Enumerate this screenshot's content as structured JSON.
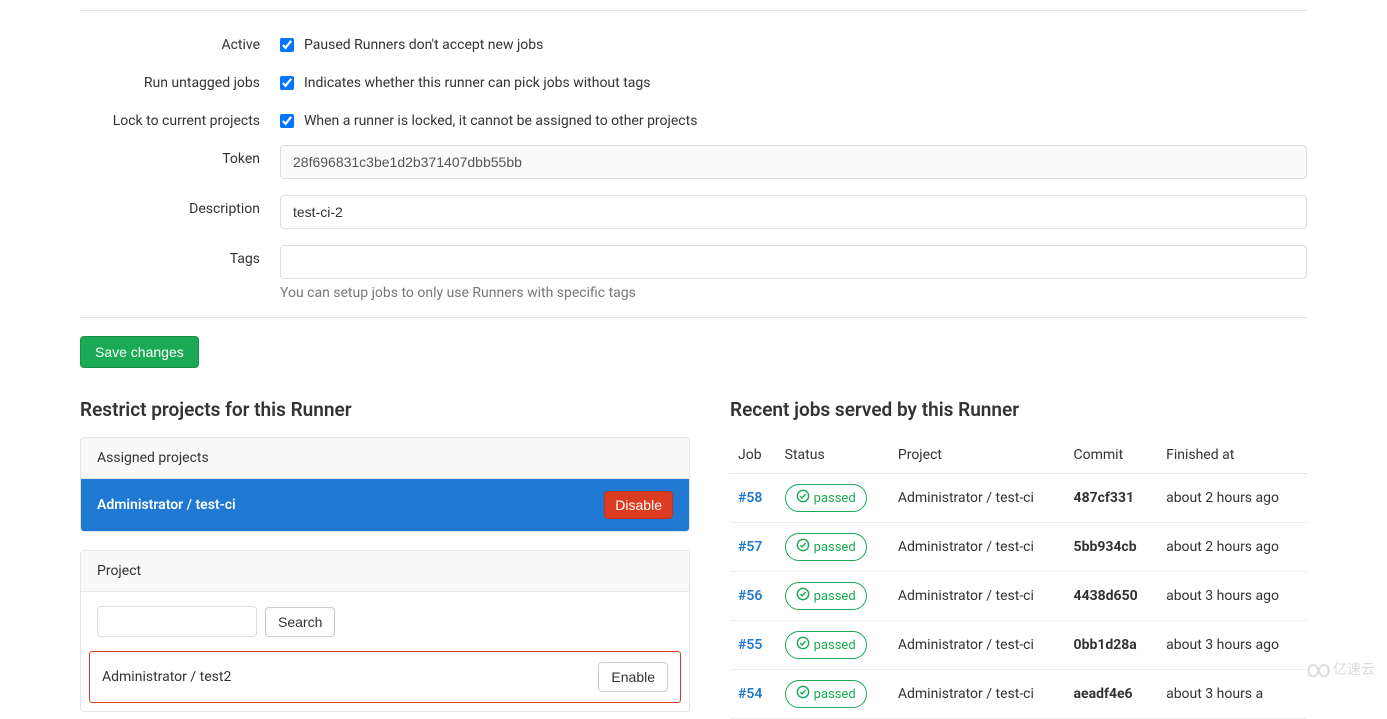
{
  "form": {
    "active": {
      "label": "Active",
      "checked": true,
      "desc": "Paused Runners don't accept new jobs"
    },
    "untagged": {
      "label": "Run untagged jobs",
      "checked": true,
      "desc": "Indicates whether this runner can pick jobs without tags"
    },
    "locked": {
      "label": "Lock to current projects",
      "checked": true,
      "desc": "When a runner is locked, it cannot be assigned to other projects"
    },
    "token": {
      "label": "Token",
      "value": "28f696831c3be1d2b371407dbb55bb"
    },
    "description": {
      "label": "Description",
      "value": "test-ci-2"
    },
    "tags": {
      "label": "Tags",
      "value": "",
      "help": "You can setup jobs to only use Runners with specific tags"
    },
    "save_label": "Save changes"
  },
  "restrict": {
    "title": "Restrict projects for this Runner",
    "assigned_header": "Assigned projects",
    "assigned_project": "Administrator / test-ci",
    "disable_label": "Disable",
    "project_header": "Project",
    "search_label": "Search",
    "available_project": "Administrator / test2",
    "enable_label": "Enable"
  },
  "recent": {
    "title": "Recent jobs served by this Runner",
    "headers": {
      "job": "Job",
      "status": "Status",
      "project": "Project",
      "commit": "Commit",
      "finished": "Finished at"
    },
    "status_passed": "passed",
    "rows": [
      {
        "job": "#58",
        "project": "Administrator / test-ci",
        "commit": "487cf331",
        "finished": "about 2 hours ago"
      },
      {
        "job": "#57",
        "project": "Administrator / test-ci",
        "commit": "5bb934cb",
        "finished": "about 2 hours ago"
      },
      {
        "job": "#56",
        "project": "Administrator / test-ci",
        "commit": "4438d650",
        "finished": "about 3 hours ago"
      },
      {
        "job": "#55",
        "project": "Administrator / test-ci",
        "commit": "0bb1d28a",
        "finished": "about 3 hours ago"
      },
      {
        "job": "#54",
        "project": "Administrator / test-ci",
        "commit": "aeadf4e6",
        "finished": "about 3 hours a"
      }
    ]
  },
  "watermark": "亿速云"
}
